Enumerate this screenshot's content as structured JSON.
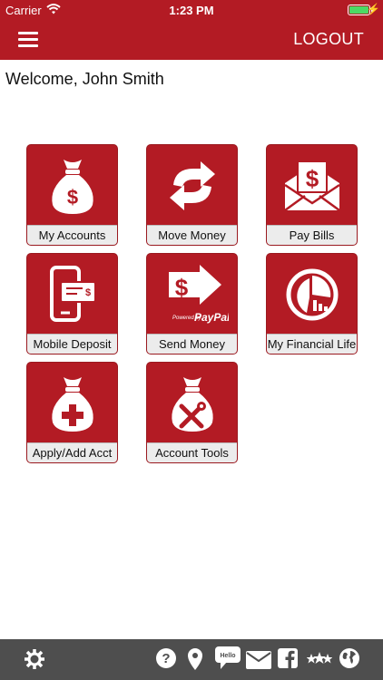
{
  "status_bar": {
    "carrier": "Carrier",
    "time": "1:23 PM"
  },
  "header": {
    "menu_icon": "hamburger-menu-icon",
    "logout_label": "LOGOUT"
  },
  "welcome_text": "Welcome, John Smith",
  "tiles": [
    {
      "label": "My Accounts",
      "icon": "money-bag-dollar-icon"
    },
    {
      "label": "Move Money",
      "icon": "refresh-arrows-icon"
    },
    {
      "label": "Pay Bills",
      "icon": "envelope-dollar-icon"
    },
    {
      "label": "Mobile Deposit",
      "icon": "phone-check-deposit-icon"
    },
    {
      "label": "Send Money",
      "icon": "paypal-send-icon",
      "badge_text": "Powered by",
      "brand_text": "PayPal"
    },
    {
      "label": "My Financial Life",
      "icon": "pie-chart-icon"
    },
    {
      "label": "Apply/Add Acct",
      "icon": "money-bag-plus-icon"
    },
    {
      "label": "Account Tools",
      "icon": "money-bag-tools-icon"
    }
  ],
  "bottom_bar": {
    "icons": [
      "gear-icon",
      "help-icon",
      "location-pin-icon",
      "chat-hello-icon",
      "mail-icon",
      "facebook-icon",
      "rating-stars-icon",
      "globe-icon"
    ],
    "chat_text": "Hello"
  },
  "colors": {
    "brand_red": "#b31b24",
    "label_bg": "#ececec",
    "bottom_bar": "#4e4e4e",
    "battery": "#4cd964"
  }
}
